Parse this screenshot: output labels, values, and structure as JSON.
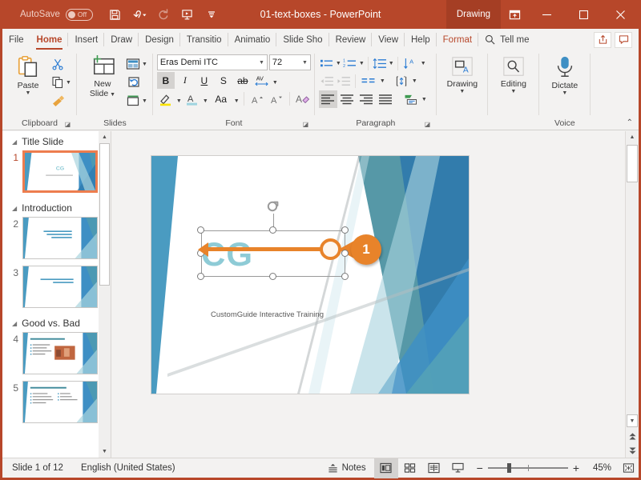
{
  "titlebar": {
    "autosave_label": "AutoSave",
    "autosave_state": "Off",
    "document_title": "01-text-boxes",
    "app_name": "PowerPoint",
    "title_full": "01-text-boxes  -  PowerPoint",
    "context_tab": "Drawing",
    "quick_access": [
      {
        "name": "save-icon",
        "label": "Save"
      },
      {
        "name": "undo-icon",
        "label": "Undo"
      },
      {
        "name": "redo-icon",
        "label": "Redo"
      },
      {
        "name": "start-slideshow-icon",
        "label": "Start From Beginning"
      },
      {
        "name": "customize-qat-icon",
        "label": "Customize Quick Access Toolbar"
      }
    ],
    "window_buttons": {
      "ribbon_display": "Ribbon Display Options",
      "minimize": "—",
      "maximize": "☐",
      "close": "✕"
    }
  },
  "tabs": [
    {
      "label": "File",
      "active": false
    },
    {
      "label": "Home",
      "active": true
    },
    {
      "label": "Insert",
      "active": false
    },
    {
      "label": "Draw",
      "active": false
    },
    {
      "label": "Design",
      "active": false
    },
    {
      "label": "Transitio",
      "active": false
    },
    {
      "label": "Animatio",
      "active": false
    },
    {
      "label": "Slide Sho",
      "active": false
    },
    {
      "label": "Review",
      "active": false
    },
    {
      "label": "View",
      "active": false
    },
    {
      "label": "Help",
      "active": false
    },
    {
      "label": "Format",
      "active": false
    }
  ],
  "tellme": {
    "label": "Tell me",
    "icon": "search-icon"
  },
  "tab_right": {
    "share_icon": "share-icon",
    "comments_icon": "comment-icon"
  },
  "ribbon": {
    "groups": [
      {
        "label": "Clipboard",
        "has_launcher": true
      },
      {
        "label": "Slides",
        "has_launcher": false
      },
      {
        "label": "Font",
        "has_launcher": true
      },
      {
        "label": "Paragraph",
        "has_launcher": true
      },
      {
        "label": "",
        "has_launcher": false
      },
      {
        "label": "",
        "has_launcher": false
      },
      {
        "label": "Voice",
        "has_launcher": false
      }
    ],
    "clipboard": {
      "paste_label": "Paste",
      "cut_label": "Cut",
      "copy_label": "Copy",
      "format_painter_label": "Format Painter"
    },
    "slides": {
      "new_slide_label": "New\nSlide",
      "new_slide_line1": "New",
      "new_slide_line2": "Slide",
      "layout_label": "Layout",
      "reset_label": "Reset",
      "section_label": "Section"
    },
    "font": {
      "font_name": "Eras Demi ITC",
      "font_size": "72",
      "bold": "B",
      "bold_active": true,
      "italic": "I",
      "underline": "U",
      "shadow": "S",
      "strikethrough": "ab",
      "char_spacing": "AV",
      "text_highlight": "Text Highlight Color",
      "font_color": "Font Color",
      "change_case": "Aa",
      "increase_size": "A",
      "decrease_size": "A",
      "clear_formatting": "A"
    },
    "paragraph": {
      "bullets": "Bullets",
      "numbering": "Numbering",
      "line_spacing": "Line Spacing",
      "text_direction": "Text Direction",
      "decrease_indent": "Decrease Indent",
      "increase_indent": "Increase Indent",
      "columns": "Columns",
      "align_text": "Align Text",
      "align_left": "Align Left",
      "align_center": "Center",
      "align_right": "Align Right",
      "justify": "Justify",
      "smartart": "Convert to SmartArt",
      "align_left_active": true
    },
    "drawing": {
      "label": "Drawing"
    },
    "editing": {
      "label": "Editing"
    },
    "voice": {
      "label": "Dictate"
    },
    "collapse_label": "Collapse the Ribbon"
  },
  "thumbnails": {
    "sections": [
      {
        "name": "Title Slide",
        "slides": [
          {
            "number": "1",
            "selected": true,
            "title": "CG",
            "subtitle": "CustomGuide Interactive Training",
            "kind": "title"
          }
        ]
      },
      {
        "name": "Introduction",
        "slides": [
          {
            "number": "2",
            "selected": false,
            "title": "What Do You Want To Know After Today's Presentation?",
            "kind": "heading"
          },
          {
            "number": "3",
            "selected": false,
            "title": "What kind of presentations are you giving?",
            "kind": "heading"
          }
        ]
      },
      {
        "name": "Good vs. Bad",
        "slides": [
          {
            "number": "4",
            "selected": false,
            "title": "What Makes a Bad Presentation?",
            "kind": "bullets-image"
          },
          {
            "number": "5",
            "selected": false,
            "title": "What Makes a Presentation Good?",
            "kind": "two-column"
          }
        ]
      }
    ]
  },
  "slide": {
    "textbox_text": "CG",
    "subtitle_text": "CustomGuide Interactive Training",
    "selection": {
      "rotate_handle": "rotate-handle",
      "handles": 8
    },
    "annotation": {
      "callout_number": "1",
      "accent_color": "#e8832a",
      "points_to": "middle-right-sizing-handle"
    },
    "theme_colors": {
      "left_wedge": "#4a9bc1",
      "teal_dark": "#3f8a9b",
      "teal_mid": "#5aa7b5",
      "teal_light": "#a9d4de",
      "blue": "#3e8fc4",
      "blue_deep": "#2f79ad",
      "title_text": "#8ecbd6",
      "subtitle_text": "#595959"
    }
  },
  "status": {
    "slide_count_text": "Slide 1 of 12",
    "language": "English (United States)",
    "notes_label": "Notes",
    "views": [
      {
        "name": "normal-view",
        "active": true
      },
      {
        "name": "slide-sorter-view",
        "active": false
      },
      {
        "name": "reading-view",
        "active": false
      },
      {
        "name": "slideshow-view",
        "active": false
      }
    ],
    "zoom_out": "−",
    "zoom_in": "+",
    "zoom_level": "45%",
    "fit_to_window": "Fit slide to current window"
  }
}
